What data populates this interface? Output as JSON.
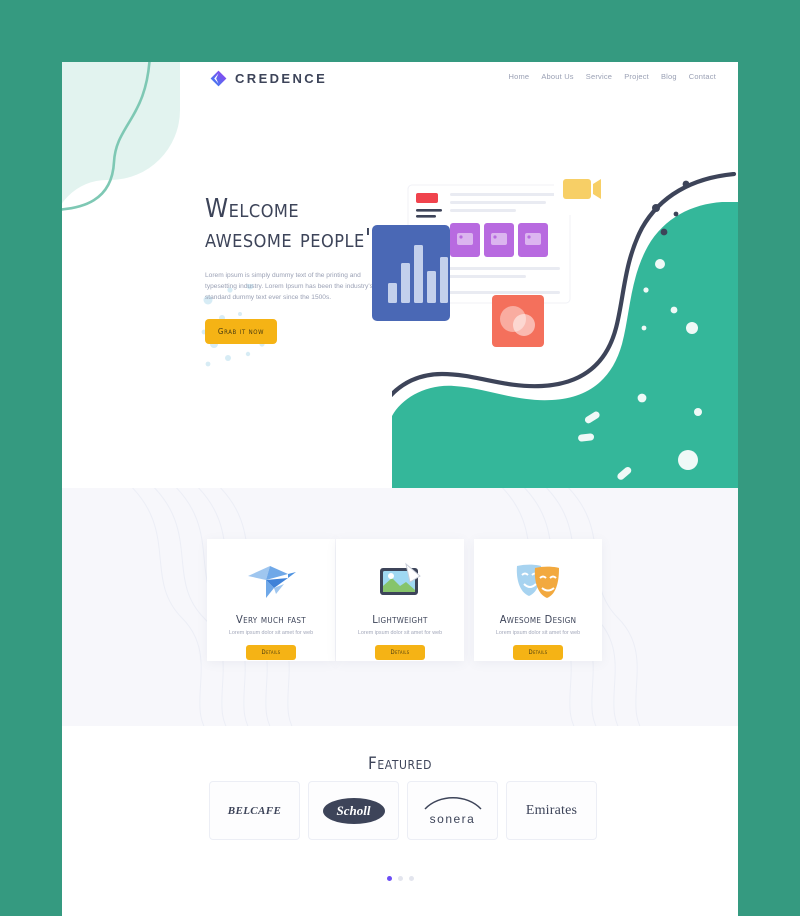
{
  "theme": {
    "page_bg": "#359a80",
    "accent_yellow": "#f5b315",
    "text_dark": "#3d4459",
    "text_muted": "#9aa0b4",
    "teal_blob": "#34b79a",
    "mint_blob": "#e2f3ef",
    "band_bg": "#f7f7fb",
    "active_dot": "#6c4df6"
  },
  "header": {
    "logo_text": "CREDENCE",
    "logo_icon": "diamond-logo-icon",
    "nav": [
      {
        "label": "Home"
      },
      {
        "label": "About Us"
      },
      {
        "label": "Service"
      },
      {
        "label": "Project"
      },
      {
        "label": "Blog"
      },
      {
        "label": "Contact"
      }
    ]
  },
  "hero": {
    "headline_line1": "Welcome",
    "headline_line2": "awesome people's",
    "paragraph": "Lorem ipsum is simply dummy text of the printing and typesetting industry. Lorem Ipsum has been the industry's standard dummy text ever since the 1500s.",
    "cta_label": "Grab it now",
    "illustration": {
      "badge_label": "",
      "cards": [
        "chart-card",
        "document-card",
        "video-card",
        "photo-card"
      ]
    }
  },
  "features": {
    "cards": [
      {
        "icon": "origami-bird-icon",
        "title": "Very much fast",
        "text": "Lorem ipsum dolor sit amet for web",
        "button": "Details"
      },
      {
        "icon": "image-tablet-icon",
        "title": "Lightweight",
        "text": "Lorem ipsum dolor sit amet for web",
        "button": "Details"
      },
      {
        "icon": "theatre-masks-icon",
        "title": "Awesome Design",
        "text": "Lorem ipsum dolor sit amet for web",
        "button": "Details"
      }
    ]
  },
  "featured": {
    "title": "Featured",
    "brands": [
      {
        "name": "BELCAFE"
      },
      {
        "name": "Scholl"
      },
      {
        "name": "sonera"
      },
      {
        "name": "Emirates"
      }
    ],
    "pagination": {
      "count": 3,
      "active_index": 0
    }
  }
}
